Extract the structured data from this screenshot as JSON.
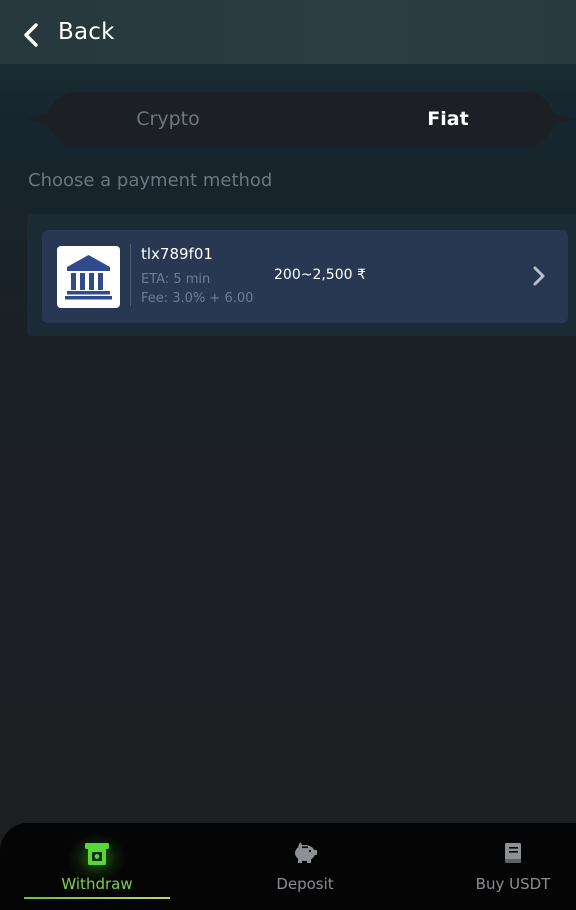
{
  "header": {
    "back_label": "Back"
  },
  "tabs": [
    {
      "label": "Crypto",
      "active": false
    },
    {
      "label": "Fiat",
      "active": true
    }
  ],
  "section_title": "Choose a payment method",
  "methods": [
    {
      "icon": "bank-icon",
      "name": "tlx789f01",
      "eta": "ETA: 5 min",
      "fee": "Fee: 3.0% + 6.00",
      "range": "200~2,500 ₹"
    }
  ],
  "bottom_nav": [
    {
      "label": "Withdraw",
      "icon": "atm-withdraw-icon",
      "active": true
    },
    {
      "label": "Deposit",
      "icon": "piggy-bank-icon",
      "active": false
    },
    {
      "label": "Buy USDT",
      "icon": "book-icon",
      "active": false
    }
  ],
  "colors": {
    "active_green": "#7cd24a",
    "card_bg": "#283853",
    "bank_blue": "#2f4b8c"
  }
}
